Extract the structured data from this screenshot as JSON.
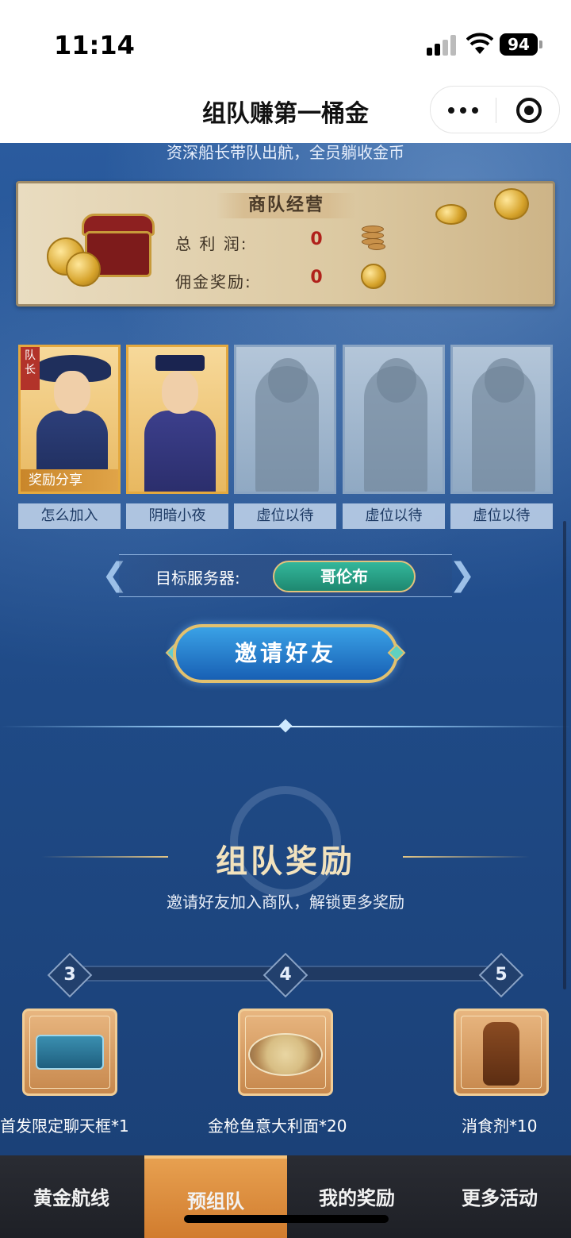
{
  "status_bar": {
    "time": "11:14",
    "battery": "94"
  },
  "nav": {
    "title": "组队赚第一桶金"
  },
  "header_subtitle": "资深船长带队出航，全员躺收金币",
  "caravan": {
    "title": "商队经营",
    "total_profit_label": "总 利 润:",
    "total_profit_value": "0",
    "commission_label": "佣金奖励:",
    "commission_value": "0"
  },
  "team": {
    "captain_badge": "队长",
    "reward_share": "奖励分享",
    "members": [
      {
        "label": "怎么加入",
        "state": "filled"
      },
      {
        "label": "阴暗小夜",
        "state": "filled"
      },
      {
        "label": "虚位以待",
        "state": "empty"
      },
      {
        "label": "虚位以待",
        "state": "empty"
      },
      {
        "label": "虚位以待",
        "state": "empty"
      }
    ]
  },
  "server": {
    "label": "目标服务器:",
    "value": "哥伦布"
  },
  "invite_button": "邀请好友",
  "rewards_section": {
    "title": "组队奖励",
    "subtitle": "邀请好友加入商队，解锁更多奖励",
    "milestones": [
      "3",
      "4",
      "5"
    ],
    "items": [
      {
        "name": "首发限定聊天框*1",
        "icon": "chat-frame-icon"
      },
      {
        "name": "金枪鱼意大利面*20",
        "icon": "pasta-icon"
      },
      {
        "name": "消食剂*10",
        "icon": "bottle-icon"
      }
    ]
  },
  "tabs": [
    {
      "label": "黄金航线",
      "active": false
    },
    {
      "label": "预组队",
      "active": true
    },
    {
      "label": "我的奖励",
      "active": false
    },
    {
      "label": "更多活动",
      "active": false
    }
  ],
  "colors": {
    "accent_gold": "#e2c16f",
    "server_green": "#2aa487",
    "tab_active": "#d98a3a",
    "value_red": "#b0211b"
  }
}
